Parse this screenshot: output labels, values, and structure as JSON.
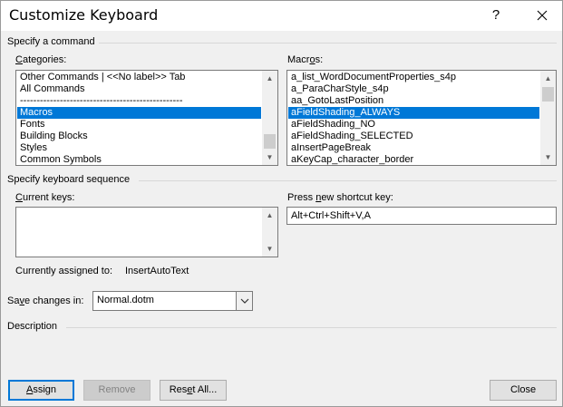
{
  "window": {
    "title": "Customize Keyboard",
    "help_glyph": "?",
    "close_glyph": "✕"
  },
  "specify_command": {
    "label": "Specify a command",
    "categories": {
      "label": "Categories:",
      "items": [
        "Other Commands | <<No label>> Tab",
        "All Commands",
        "-------------------------------------------------",
        "Macros",
        "Fonts",
        "Building Blocks",
        "Styles",
        "Common Symbols"
      ],
      "selected_index": 3
    },
    "macros": {
      "label": "Macros:",
      "items": [
        "a_list_WordDocumentProperties_s4p",
        "a_ParaCharStyle_s4p",
        "aa_GotoLastPosition",
        "aFieldShading_ALWAYS",
        "aFieldShading_NO",
        "aFieldShading_SELECTED",
        "aInsertPageBreak",
        "aKeyCap_character_border"
      ],
      "selected_index": 3
    }
  },
  "keyboard_sequence": {
    "label": "Specify keyboard sequence",
    "current_keys_label": "Current keys:",
    "current_keys_value": "",
    "new_shortcut_label": "Press new shortcut key:",
    "new_shortcut_value": "Alt+Ctrl+Shift+V,A",
    "assigned_label": "Currently assigned to:",
    "assigned_value": "InsertAutoText"
  },
  "save_changes": {
    "label": "Save changes in:",
    "value": "Normal.dotm"
  },
  "description": {
    "label": "Description"
  },
  "buttons": {
    "assign": "Assign",
    "remove": "Remove",
    "reset_all": "Reset All...",
    "close": "Close"
  },
  "colors": {
    "selection": "#0078d7",
    "background": "#f0f0f0",
    "default_button_border": "#0078d7"
  }
}
